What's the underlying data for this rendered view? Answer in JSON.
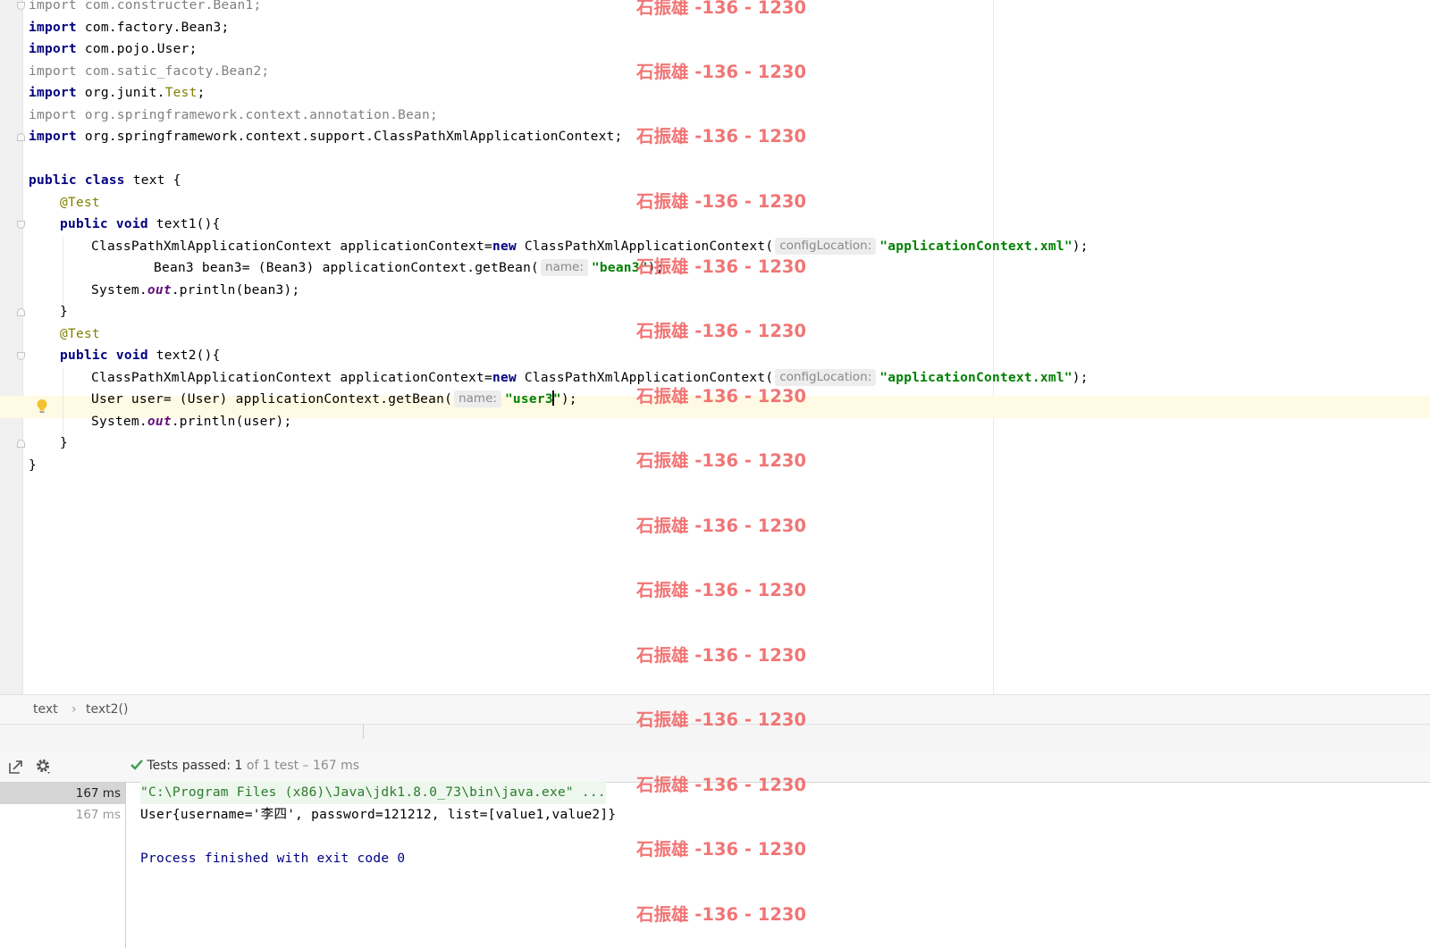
{
  "editor": {
    "imports": [
      {
        "kw": "import",
        "pkg": "com.constructer.Bean1;",
        "dim": true
      },
      {
        "kw": "import",
        "pkg": "com.factory.Bean3;",
        "dim": false
      },
      {
        "kw": "import",
        "pkg": "com.pojo.User;",
        "dim": false
      },
      {
        "kw": "import",
        "pkg": "com.satic_facoty.Bean2;",
        "dim": true
      },
      {
        "kw": "import",
        "pkg": "org.junit.",
        "cls": "Test",
        "end": ";",
        "dim": false
      },
      {
        "kw": "import",
        "pkg": "org.springframework.context.annotation.Bean;",
        "dim": true
      },
      {
        "kw": "import",
        "pkg": "org.springframework.context.support.ClassPathXmlApplicationContext;",
        "dim": false
      }
    ],
    "kw_public": "public",
    "kw_class": "class",
    "kw_void": "void",
    "kw_new": "new",
    "class_name": " text {",
    "annotation": "@Test",
    "method1": {
      "sig": " text1(){",
      "ctx_left": "ClassPathXmlApplicationContext applicationContext=",
      "ctx_right": " ClassPathXmlApplicationContext(",
      "hint_config": "configLocation:",
      "xml": "\"applicationContext.xml\"",
      "close_paren": ");",
      "getbean_left": "Bean3 bean3= (Bean3) applicationContext.getBean(",
      "hint_name": "name:",
      "bean_str": "\"bean3\"",
      "print_left": "System.",
      "print_field": "out",
      "print_right": ".println(bean3);"
    },
    "method2": {
      "sig": " text2(){",
      "getbean_left": "User user= (User) applicationContext.getBean(",
      "user_str_a": "\"user3",
      "user_str_b": "\"",
      "print_right": ".println(user);"
    },
    "brace_close": "}"
  },
  "breadcrumb": {
    "class_item": "text",
    "separator": "›",
    "method_item": "text2()"
  },
  "run_panel": {
    "status_passed": "Tests passed:",
    "status_count": "1",
    "status_rest": "of 1 test – 167 ms",
    "test_rows": [
      {
        "time": "167 ms",
        "selected": true
      },
      {
        "time": "167 ms",
        "selected": false
      }
    ],
    "console_cmd": "\"C:\\Program Files (x86)\\Java\\jdk1.8.0_73\\bin\\java.exe\" ...",
    "console_output": "User{username='李四', password=121212, list=[value1,value2]}",
    "console_finished": "Process finished with exit code 0"
  },
  "watermark": "石振雄 -136 - 1230",
  "icons": [
    "lightbulb-icon",
    "fold-marker-icon",
    "restore-layout-icon",
    "gear-icon",
    "check-icon"
  ]
}
